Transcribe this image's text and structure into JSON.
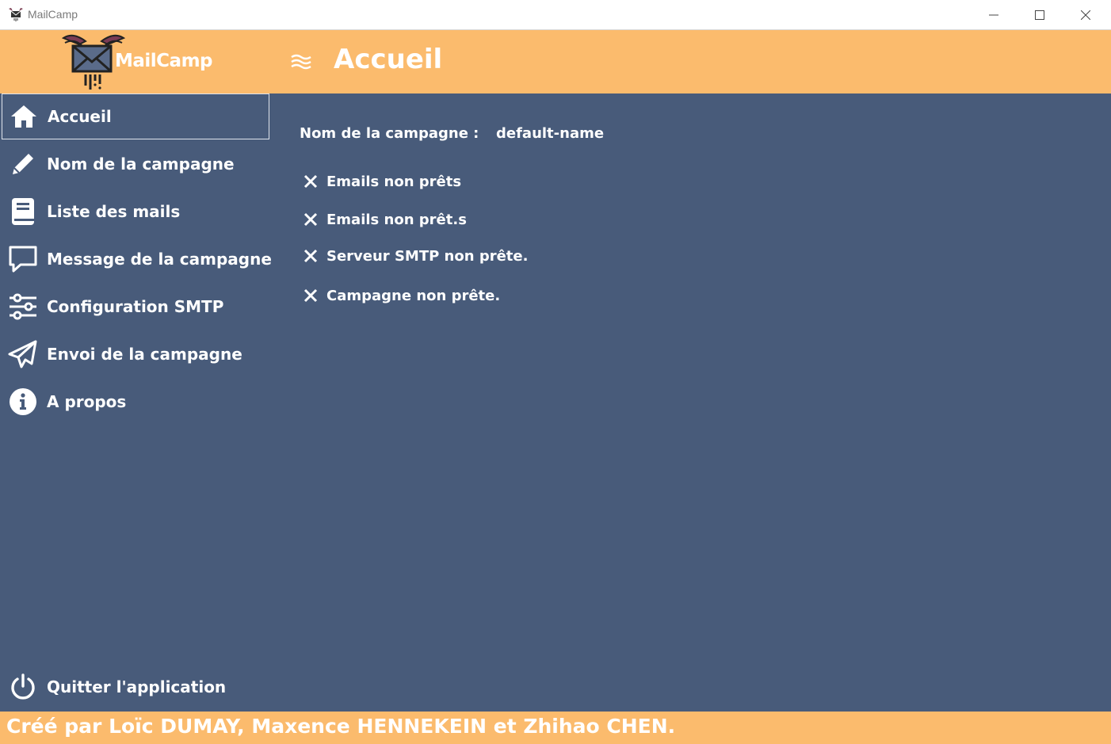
{
  "window": {
    "title": "MailCamp",
    "controls": [
      "minimize-icon",
      "maximize-icon",
      "close-icon"
    ]
  },
  "header": {
    "brand": "MailCamp",
    "page_title": "Accueil",
    "menu_icon": "hamburger-icon"
  },
  "sidebar": {
    "items": [
      {
        "label": "Accueil",
        "icon": "home-icon",
        "active": true
      },
      {
        "label": "Nom de la campagne",
        "icon": "pencil-icon",
        "active": false
      },
      {
        "label": "Liste des mails",
        "icon": "book-icon",
        "active": false
      },
      {
        "label": "Message de la campagne",
        "icon": "chat-icon",
        "active": false
      },
      {
        "label": "Configuration SMTP",
        "icon": "sliders-icon",
        "active": false
      },
      {
        "label": "Envoi de la campagne",
        "icon": "paper-plane-icon",
        "active": false
      },
      {
        "label": "A propos",
        "icon": "info-icon",
        "active": false
      }
    ],
    "quit": {
      "label": "Quitter l'application",
      "icon": "power-icon"
    }
  },
  "main": {
    "campaign_name_label": "Nom de la campagne :",
    "campaign_name_value": "default-name",
    "status": [
      {
        "text": "Emails non prêts",
        "icon": "x-icon"
      },
      {
        "text": "Emails non prêt.s",
        "icon": "x-icon"
      },
      {
        "text": "Serveur SMTP non prête.",
        "icon": "x-icon"
      },
      {
        "text": "Campagne non prête.",
        "icon": "x-icon"
      }
    ]
  },
  "footer": {
    "credits": "Créé par Loïc DUMAY, Maxence HENNEKEIN et Zhihao CHEN."
  },
  "colors": {
    "accent": "#fbbb6d",
    "background": "#485b7a",
    "text": "#ffffff"
  }
}
